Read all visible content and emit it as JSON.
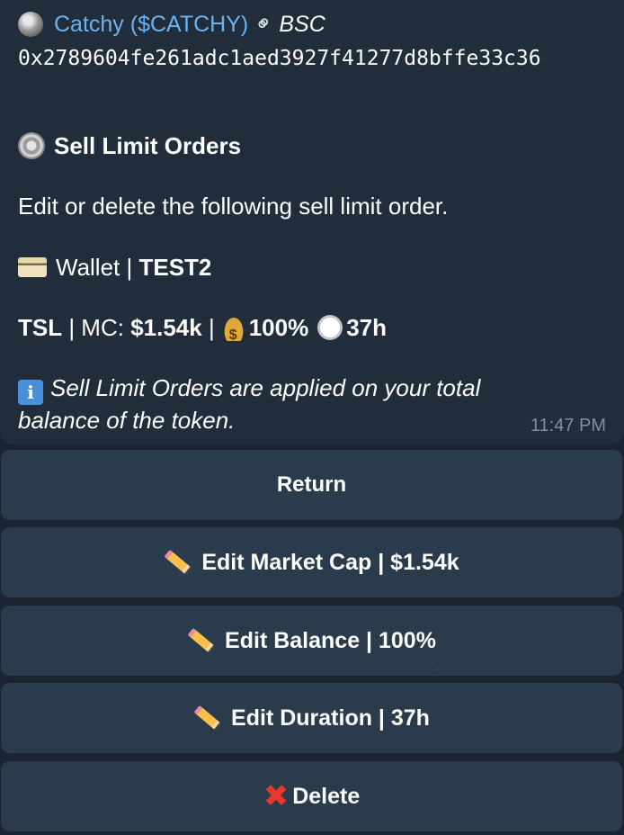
{
  "message": {
    "token_name": "Catchy ($CATCHY)",
    "chain": "BSC",
    "address": "0x2789604fe261adc1aed3927f41277d8bffe33c36",
    "heading": "Sell Limit Orders",
    "subtitle": "Edit or delete the following sell limit order.",
    "wallet_label": "Wallet | ",
    "wallet_name": "TEST2",
    "order_prefix": "TSL | MC: ",
    "order_mc": "$1.54k",
    "order_sep": " |",
    "order_balance": "100%",
    "order_duration": "37h",
    "info_text": "Sell Limit Orders are applied on your total balance of the token.",
    "time": "11:47 PM"
  },
  "buttons": {
    "return": "Return",
    "edit_market_cap": "Edit Market Cap | $1.54k",
    "edit_balance": "Edit Balance | 100%",
    "edit_duration": "Edit Duration | 37h",
    "delete": "Delete"
  },
  "icons": {
    "token": "token-avatar-icon",
    "link": "link-icon",
    "gear": "gear-icon",
    "card": "credit-card-icon",
    "money": "money-bag-icon",
    "timer": "stopwatch-icon",
    "info": "info-icon",
    "pencil": "pencil-icon",
    "cross": "cross-mark-icon"
  },
  "colors": {
    "link": "#6ab2f2",
    "bubble": "#212d3b",
    "button": "#2e3f50",
    "timestamp": "#7e8f9f",
    "cross": "#e8382c"
  }
}
